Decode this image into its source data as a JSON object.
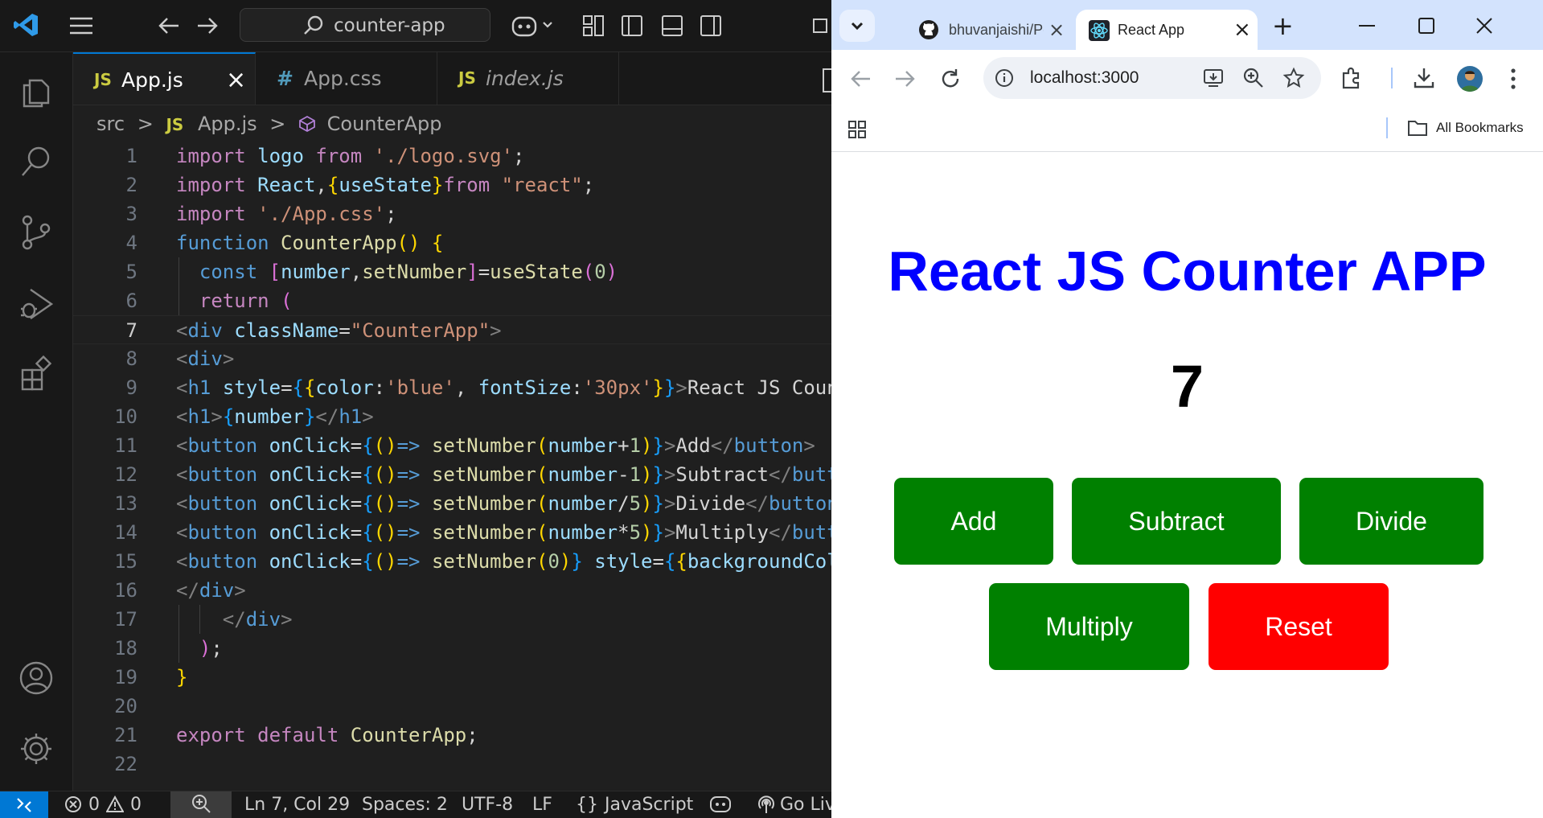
{
  "vscode": {
    "title_search": "counter-app",
    "tabs": [
      {
        "icon": "JS",
        "label": "App.js",
        "close": "×"
      },
      {
        "icon": "#",
        "label": "App.css"
      },
      {
        "icon": "JS",
        "label": "index.js"
      }
    ],
    "breadcrumb": {
      "folder": "src",
      "sep": ">",
      "file_icon": "JS",
      "file": "App.js",
      "symbol": "CounterApp"
    },
    "line_numbers": [
      "1",
      "2",
      "3",
      "4",
      "5",
      "6",
      "7",
      "8",
      "9",
      "10",
      "11",
      "12",
      "13",
      "14",
      "15",
      "16",
      "17",
      "18",
      "19",
      "20",
      "21",
      "22"
    ],
    "status": {
      "errors": "0",
      "warnings": "0",
      "position": "Ln 7, Col 29",
      "spaces": "Spaces: 2",
      "encoding": "UTF-8",
      "eol": "LF",
      "lang_braces": "{}",
      "language": "JavaScript",
      "golive": "Go Liv"
    },
    "colors": {
      "accent": "#0078d4",
      "bg": "#1f1f1f"
    }
  },
  "browser": {
    "tabs": [
      {
        "label": "bhuvanjaishi/Per",
        "icon": "github-icon"
      },
      {
        "label": "React App",
        "icon": "react-icon",
        "close": "×"
      }
    ],
    "new_tab": "+",
    "address": "localhost:3000",
    "bookmarks_label": "All Bookmarks"
  },
  "app": {
    "title": "React JS Counter APP",
    "number": "7",
    "buttons": {
      "add": "Add",
      "subtract": "Subtract",
      "divide": "Divide",
      "multiply": "Multiply",
      "reset": "Reset"
    },
    "colors": {
      "title": "#0000ff",
      "button": "#008000",
      "reset": "#ff0000"
    }
  }
}
